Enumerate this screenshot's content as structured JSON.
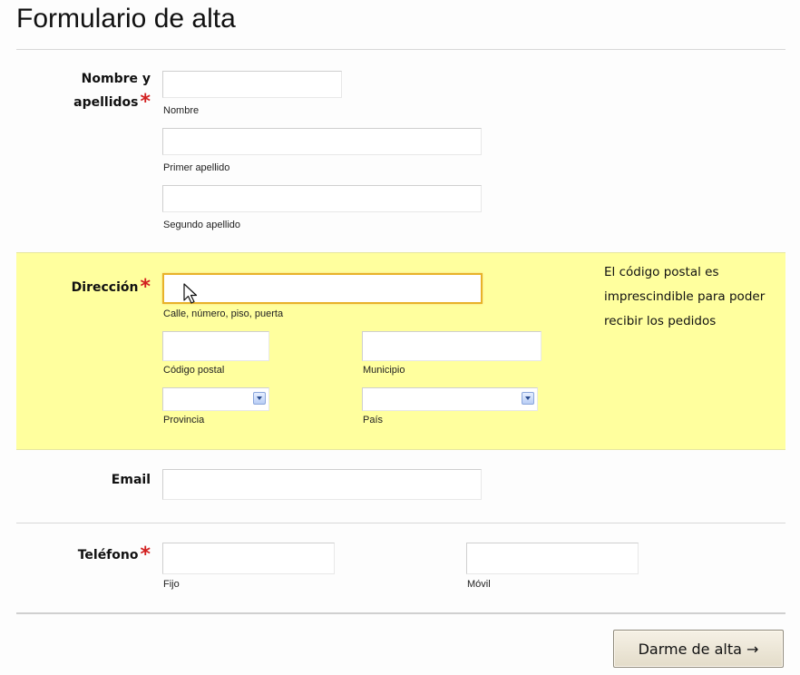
{
  "form": {
    "title": "Formulario de alta",
    "required_mark": "*",
    "name_section": {
      "label": "Nombre y apellidos",
      "label_line1": "Nombre y",
      "label_line2": "apellidos",
      "fields": [
        {
          "sublabel": "Nombre",
          "value": ""
        },
        {
          "sublabel": "Primer apellido",
          "value": ""
        },
        {
          "sublabel": "Segundo apellido",
          "value": ""
        }
      ]
    },
    "address_section": {
      "label": "Dirección",
      "street": {
        "sublabel": "Calle, número, piso, puerta",
        "value": ""
      },
      "postal_code": {
        "sublabel": "Código postal",
        "value": ""
      },
      "city": {
        "sublabel": "Municipio",
        "value": ""
      },
      "province": {
        "sublabel": "Provincia",
        "selected": ""
      },
      "country": {
        "sublabel": "País",
        "selected": ""
      },
      "help_text": "El código postal es imprescindible para poder recibir los pedidos"
    },
    "email_section": {
      "label": "Email",
      "value": ""
    },
    "phone_section": {
      "label": "Teléfono",
      "landline": {
        "sublabel": "Fijo",
        "value": ""
      },
      "mobile": {
        "sublabel": "Móvil",
        "value": ""
      }
    },
    "submit_label": "Darme de alta →"
  },
  "colors": {
    "highlight_bg": "#ffff9e",
    "required": "#d22020",
    "focus_border": "#e8b22a"
  }
}
